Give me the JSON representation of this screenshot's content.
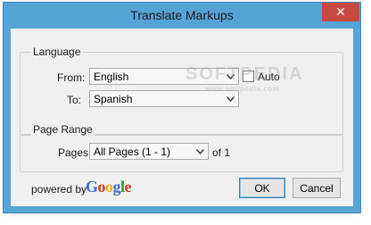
{
  "window": {
    "title": "Translate Markups",
    "close_symbol": "✕"
  },
  "language": {
    "legend": "Language",
    "from_label": "From:",
    "from_value": "English",
    "auto_label": "Auto",
    "auto_checked": false,
    "to_label": "To:",
    "to_value": "Spanish"
  },
  "page_range": {
    "legend": "Page Range",
    "pages_label": "Pages",
    "pages_value": "All Pages (1 - 1)",
    "of_text": "of 1"
  },
  "footer": {
    "powered_by": "powered by",
    "google_letters": [
      "G",
      "o",
      "o",
      "g",
      "l",
      "e"
    ],
    "google_colors": [
      "#3b6fd8",
      "#d5372c",
      "#eeb211",
      "#3b6fd8",
      "#2e9a3a",
      "#d5372c"
    ],
    "ok_label": "OK",
    "cancel_label": "Cancel"
  },
  "watermark": {
    "main": "SOFTPEDIA",
    "sub": "www.softpedia.com"
  }
}
